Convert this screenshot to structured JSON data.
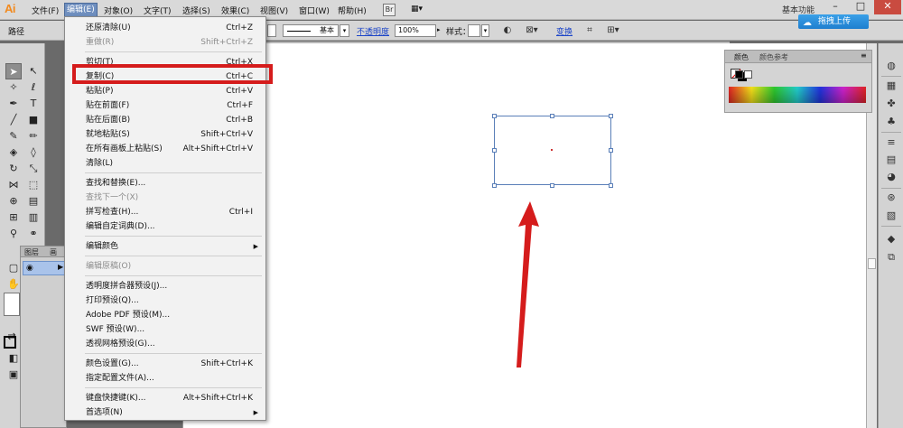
{
  "app": {
    "logo": "Ai",
    "workspace": "基本功能",
    "bridge_icon": "Br",
    "arrange_icon": "arrange-documents-icon"
  },
  "menubar": [
    "文件(F)",
    "编辑(E)",
    "对象(O)",
    "文字(T)",
    "选择(S)",
    "效果(C)",
    "视图(V)",
    "窗口(W)",
    "帮助(H)"
  ],
  "window_buttons": {
    "minimize": "–",
    "maximize": "□",
    "close": "✕"
  },
  "controlbar": {
    "path_label": "路径",
    "stroke_style": "基本",
    "opacity_link": "不透明度",
    "opacity_value": "100%",
    "style_label": "样式：",
    "transform_link": "变换",
    "upload_button": "拖拽上传"
  },
  "edit_menu": [
    {
      "label": "还原清除(U)",
      "shortcut": "Ctrl+Z",
      "disabled": false
    },
    {
      "label": "重做(R)",
      "shortcut": "Shift+Ctrl+Z",
      "disabled": true
    },
    {
      "sep": true
    },
    {
      "label": "剪切(T)",
      "shortcut": "Ctrl+X",
      "disabled": false
    },
    {
      "label": "复制(C)",
      "shortcut": "Ctrl+C",
      "disabled": false
    },
    {
      "label": "粘贴(P)",
      "shortcut": "Ctrl+V",
      "disabled": false
    },
    {
      "label": "贴在前面(F)",
      "shortcut": "Ctrl+F",
      "disabled": false
    },
    {
      "label": "贴在后面(B)",
      "shortcut": "Ctrl+B",
      "disabled": false
    },
    {
      "label": "就地粘贴(S)",
      "shortcut": "Shift+Ctrl+V",
      "disabled": false
    },
    {
      "label": "在所有画板上粘贴(S)",
      "shortcut": "Alt+Shift+Ctrl+V",
      "disabled": false
    },
    {
      "label": "清除(L)",
      "shortcut": "",
      "disabled": false
    },
    {
      "sep": true
    },
    {
      "label": "查找和替换(E)...",
      "shortcut": "",
      "disabled": false
    },
    {
      "label": "查找下一个(X)",
      "shortcut": "",
      "disabled": true
    },
    {
      "label": "拼写检查(H)...",
      "shortcut": "Ctrl+I",
      "disabled": false
    },
    {
      "label": "编辑自定词典(D)...",
      "shortcut": "",
      "disabled": false
    },
    {
      "sep": true
    },
    {
      "label": "编辑颜色",
      "shortcut": "",
      "disabled": false,
      "submenu": true
    },
    {
      "sep": true
    },
    {
      "label": "编辑原稿(O)",
      "shortcut": "",
      "disabled": true
    },
    {
      "sep": true
    },
    {
      "label": "透明度拼合器预设(J)...",
      "shortcut": "",
      "disabled": false
    },
    {
      "label": "打印预设(Q)...",
      "shortcut": "",
      "disabled": false
    },
    {
      "label": "Adobe PDF 预设(M)...",
      "shortcut": "",
      "disabled": false
    },
    {
      "label": "SWF 预设(W)...",
      "shortcut": "",
      "disabled": false
    },
    {
      "label": "透视网格预设(G)...",
      "shortcut": "",
      "disabled": false
    },
    {
      "sep": true
    },
    {
      "label": "颜色设置(G)...",
      "shortcut": "Shift+Ctrl+K",
      "disabled": false
    },
    {
      "label": "指定配置文件(A)...",
      "shortcut": "",
      "disabled": false
    },
    {
      "sep": true
    },
    {
      "label": "键盘快捷键(K)...",
      "shortcut": "Alt+Shift+Ctrl+K",
      "disabled": false
    },
    {
      "label": "首选项(N)",
      "shortcut": "",
      "disabled": false,
      "submenu": true
    }
  ],
  "color_panel": {
    "tab_color": "颜色",
    "tab_guide": "颜色参考"
  },
  "layers_panel": {
    "tab_layers": "图层",
    "tab_artboards": "画"
  },
  "colors": {
    "highlight": "#d51c1c",
    "arrow": "#d51c1c",
    "menu_active": "#6f8fbf",
    "selection": "#5a7fb8"
  }
}
